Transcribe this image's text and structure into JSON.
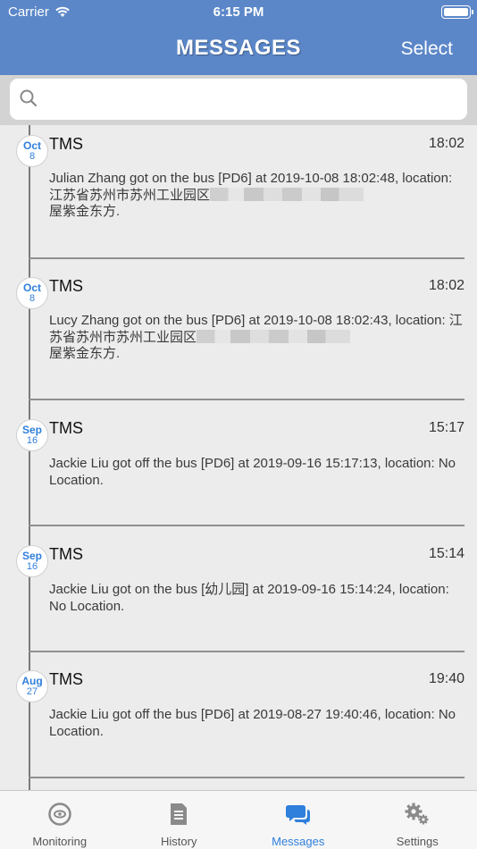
{
  "status_bar": {
    "carrier": "Carrier",
    "time": "6:15 PM"
  },
  "nav": {
    "title": "MESSAGES",
    "select_label": "Select"
  },
  "search": {
    "placeholder": ""
  },
  "messages": [
    {
      "month": "Oct",
      "day": "8",
      "sender": "TMS",
      "time": "18:02",
      "text_before": "Julian Zhang got on the bus [PD6] at 2019-10-08 18:02:48, location: 江苏省苏州市苏州工业园区",
      "redacted": true,
      "text_after": "屋紫金东方."
    },
    {
      "month": "Oct",
      "day": "8",
      "sender": "TMS",
      "time": "18:02",
      "text_before": "Lucy Zhang got on the bus [PD6] at 2019-10-08 18:02:43, location: 江苏省苏州市苏州工业园区",
      "redacted": true,
      "text_after": "屋紫金东方."
    },
    {
      "month": "Sep",
      "day": "16",
      "sender": "TMS",
      "time": "15:17",
      "text_before": "Jackie Liu got off the bus [PD6] at 2019-09-16 15:17:13, location: No Location.",
      "redacted": false,
      "text_after": ""
    },
    {
      "month": "Sep",
      "day": "16",
      "sender": "TMS",
      "time": "15:14",
      "text_before": "Jackie Liu got on the bus [幼儿园] at 2019-09-16 15:14:24, location: No Location.",
      "redacted": false,
      "text_after": ""
    },
    {
      "month": "Aug",
      "day": "27",
      "sender": "TMS",
      "time": "19:40",
      "text_before": "Jackie Liu got off the bus [PD6] at 2019-08-27 19:40:46, location: No Location.",
      "redacted": false,
      "text_after": ""
    }
  ],
  "tabs": [
    {
      "label": "Monitoring",
      "icon": "monitoring-icon",
      "active": false
    },
    {
      "label": "History",
      "icon": "history-icon",
      "active": false
    },
    {
      "label": "Messages",
      "icon": "messages-icon",
      "active": true
    },
    {
      "label": "Settings",
      "icon": "settings-icon",
      "active": false
    }
  ],
  "colors": {
    "nav": "#5b87c8",
    "accent": "#2f7fdc",
    "background": "#ececec"
  }
}
